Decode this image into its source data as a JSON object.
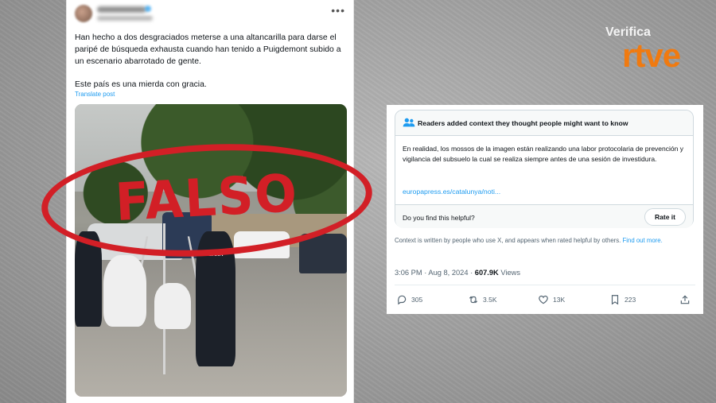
{
  "tweet": {
    "text_p1": "Han hecho a dos desgraciados meterse a una altancarilla para darse el paripé de búsqueda exhausta cuando han tenido a Puigdemont subido a un escenario abarrotado de gente.",
    "text_p2": "Este país es una mierda con gracia.",
    "translate_label": "Translate post",
    "photo_police_label": "POLICIA",
    "more_icon": "more-horizontal-icon"
  },
  "stamp": {
    "label": "FALSO",
    "color": "#d21f26"
  },
  "community_note": {
    "title": "Readers added context they thought people might want to know",
    "body": "En realidad, los mossos de la imagen están realizando una labor protocolaria de prevención y vigilancia del subsuelo la cual se realiza siempre antes de una sesión de investidura.",
    "link": "europapress.es/catalunya/noti...",
    "helpful_question": "Do you find this helpful?",
    "rate_button": "Rate it",
    "context_note": "Context is written by people who use X, and appears when rated helpful by others.",
    "find_out_more": "Find out more."
  },
  "meta": {
    "time_date": "3:06 PM · Aug 8, 2024 · ",
    "views_count": "607.9K",
    "views_label": " Views"
  },
  "actions": {
    "replies": "305",
    "reposts": "3.5K",
    "likes": "13K",
    "bookmarks": "223"
  },
  "logo": {
    "top": "Verifica",
    "bottom": "rtve",
    "accent": "#f07a10"
  },
  "colors": {
    "link_blue": "#1d9bf0",
    "text": "#0f1419",
    "muted": "#536471"
  }
}
